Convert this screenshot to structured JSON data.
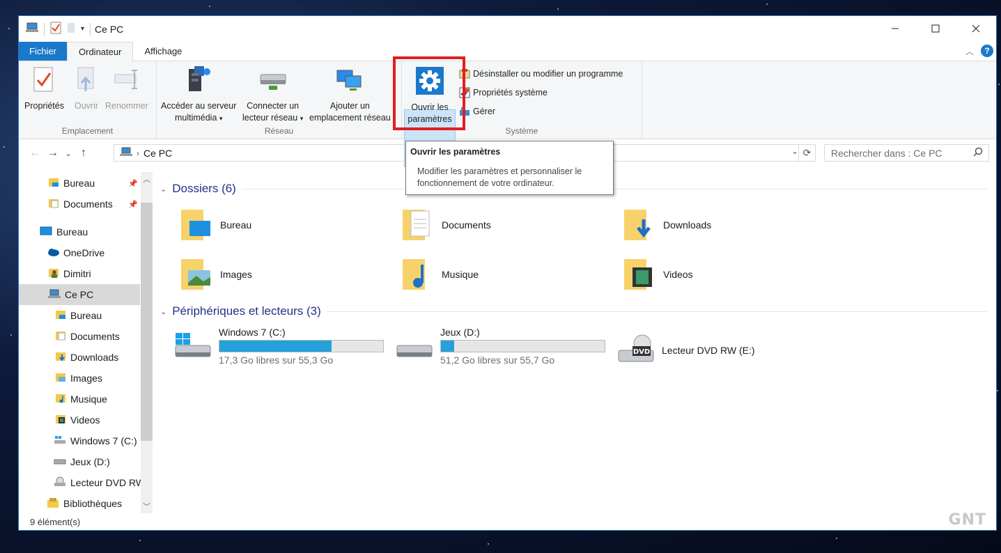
{
  "window": {
    "title": "Ce PC",
    "controls": [
      "minimize",
      "maximize",
      "close"
    ]
  },
  "ribbon_tabs": {
    "file": "Fichier",
    "computer": "Ordinateur",
    "view": "Affichage"
  },
  "ribbon": {
    "location_group": "Emplacement",
    "network_group": "Réseau",
    "system_group": "Système",
    "properties": "Propriétés",
    "open": "Ouvrir",
    "rename": "Renommer",
    "media_server_line1": "Accéder au serveur",
    "media_server_line2": "multimédia",
    "map_drive_line1": "Connecter un",
    "map_drive_line2": "lecteur réseau",
    "add_location_line1": "Ajouter un",
    "add_location_line2": "emplacement réseau",
    "open_settings_line1": "Ouvrir les",
    "open_settings_line2": "paramètres",
    "uninstall": "Désinstaller ou modifier un programme",
    "system_properties": "Propriétés système",
    "manage": "Gérer"
  },
  "tooltip": {
    "title": "Ouvrir les paramètres",
    "description_line1": "Modifier les paramètres et personnaliser le",
    "description_line2": "fonctionnement de votre ordinateur."
  },
  "address": {
    "path": "Ce PC",
    "search_placeholder": "Rechercher dans : Ce PC"
  },
  "nav_pane": {
    "items": [
      {
        "label": "Bureau"
      },
      {
        "label": "Documents"
      },
      {
        "label": "Bureau"
      },
      {
        "label": "OneDrive"
      },
      {
        "label": "Dimitri"
      },
      {
        "label": "Ce PC"
      },
      {
        "label": "Bureau"
      },
      {
        "label": "Documents"
      },
      {
        "label": "Downloads"
      },
      {
        "label": "Images"
      },
      {
        "label": "Musique"
      },
      {
        "label": "Videos"
      },
      {
        "label": "Windows 7 (C:)"
      },
      {
        "label": "Jeux (D:)"
      },
      {
        "label": "Lecteur DVD RW (E:)"
      },
      {
        "label": "Bibliothèques"
      }
    ]
  },
  "folders_section": {
    "title": "Dossiers (6)",
    "folders": [
      {
        "name": "Bureau"
      },
      {
        "name": "Documents"
      },
      {
        "name": "Downloads"
      },
      {
        "name": "Images"
      },
      {
        "name": "Musique"
      },
      {
        "name": "Videos"
      }
    ]
  },
  "drives_section": {
    "title": "Périphériques et lecteurs (3)",
    "drives": [
      {
        "name": "Windows 7 (C:)",
        "free": "17,3 Go libres sur 55,3 Go",
        "used_fraction": 0.687
      },
      {
        "name": "Jeux (D:)",
        "free": "51,2 Go libres sur 55,7 Go",
        "used_fraction": 0.081
      },
      {
        "name": "Lecteur DVD RW (E:)"
      }
    ]
  },
  "status": {
    "count": "9 élément(s)"
  },
  "watermark": "GNT",
  "colors": {
    "accent": "#1979ca",
    "drive_bar": "#26a0da",
    "section_title": "#1e3287",
    "highlight_box": "#e0201f"
  }
}
